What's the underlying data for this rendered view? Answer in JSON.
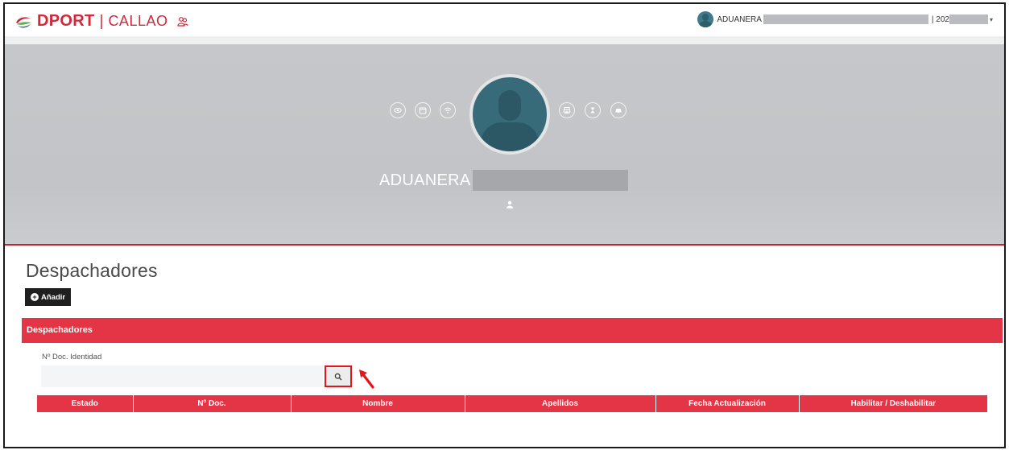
{
  "colors": {
    "brand_red": "#d3283b",
    "panel_red": "#e33546",
    "highlight_red": "#e4141b",
    "hero_gray": "#c4c6c9"
  },
  "header": {
    "brand": "DPORT",
    "separator": "|",
    "city": "CALLAO",
    "user": {
      "name": "ADUANERA",
      "year": "| 202"
    }
  },
  "hero": {
    "name": "ADUANERA",
    "left_icons": [
      "eye-icon",
      "calendar-icon",
      "wifi-icon"
    ],
    "right_icons": [
      "printer-icon",
      "hourglass-icon",
      "car-icon"
    ]
  },
  "page": {
    "title": "Despachadores",
    "add_button": "Añadir"
  },
  "panel": {
    "title": "Despachadores",
    "field_label": "Nº Doc. Identidad",
    "field_value": "",
    "field_placeholder": "",
    "search_icon": "search-icon"
  },
  "table": {
    "columns": [
      "Estado",
      "Nº Doc.",
      "Nombre",
      "Apellidos",
      "Fecha Actualización",
      "Habilitar / Deshabilitar"
    ],
    "rows": []
  }
}
